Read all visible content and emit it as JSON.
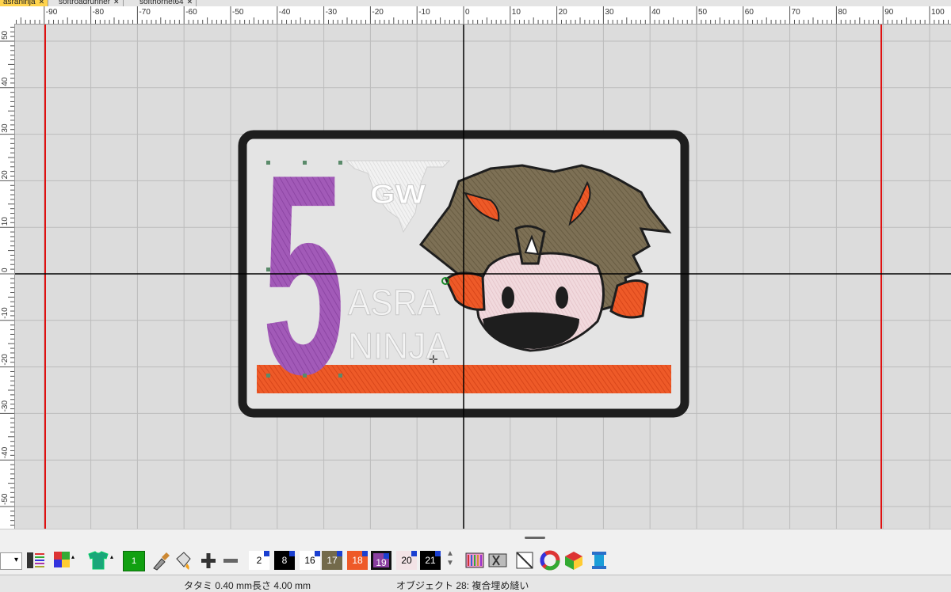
{
  "tabs": [
    {
      "label": "asraninja",
      "close": "✕",
      "active": true
    },
    {
      "label": "softroadrunner",
      "close": "✕",
      "active": false
    },
    {
      "label": "softhornet64",
      "close": "✕",
      "active": false
    }
  ],
  "ruler": {
    "horizontal_labels": [
      "-90",
      "-80",
      "-70",
      "-60",
      "-50",
      "-40",
      "-30",
      "-20",
      "-10",
      "0",
      "10",
      "20",
      "30",
      "40",
      "50",
      "60",
      "70",
      "80",
      "90",
      "100"
    ],
    "vertical_labels": [
      "50",
      "40",
      "30",
      "20",
      "10",
      "0",
      "-10",
      "-20",
      "-30",
      "-40",
      "-50"
    ]
  },
  "design": {
    "number": "5",
    "line1": "ASRA",
    "line2": "NINJA",
    "colors": {
      "border": "#1e1e1e",
      "purple": "#a25ab8",
      "orange": "#ee5a28",
      "khaki": "#7d7055",
      "white_thread": "#f4f4f4",
      "skin": "#f1d9dd",
      "guide_red": "#e01010"
    }
  },
  "toolbar": {
    "swatches": [
      {
        "label": "2",
        "bg": "#ffffff",
        "fg": "#000000"
      },
      {
        "label": "8",
        "bg": "#000000",
        "fg": "#ffffff"
      },
      {
        "label": "16",
        "bg": "#ffffff",
        "fg": "#000000"
      },
      {
        "label": "17",
        "bg": "#736a4b",
        "fg": "#ffffff"
      },
      {
        "label": "18",
        "bg": "#ee5a28",
        "fg": "#ffffff"
      },
      {
        "label": "19",
        "bg": "#8a3fa0",
        "fg": "#ffffff"
      },
      {
        "label": "20",
        "bg": "#f3e3e6",
        "fg": "#000000"
      },
      {
        "label": "21",
        "bg": "#000000",
        "fg": "#ffffff"
      }
    ],
    "active_color_label": "1",
    "icons": [
      "color-palette-icon",
      "tshirt-icon",
      "eyedropper-icon",
      "paint-bucket-icon",
      "plus-icon",
      "minus-icon",
      "stitch-view-icon",
      "fabric-icon",
      "no-fill-icon",
      "color-wheel-icon",
      "3d-cube-icon",
      "spool-icon"
    ]
  },
  "status": {
    "stitch_info": "タタミ  0.40 mm長さ  4.00 mm",
    "object_info": "オブジェクト 28: 複合埋め縫い"
  }
}
